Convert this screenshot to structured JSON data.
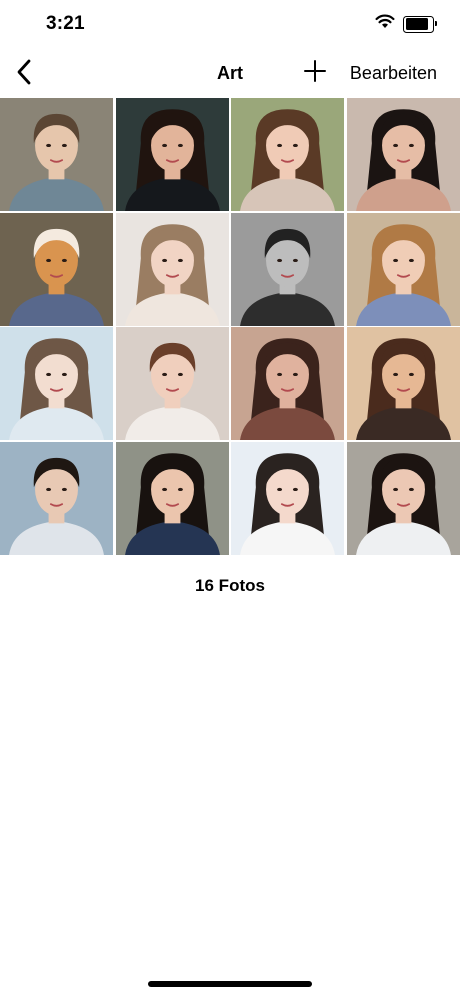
{
  "status_bar": {
    "time": "3:21",
    "battery_level": 0.85
  },
  "nav": {
    "title": "Art",
    "edit_label": "Bearbeiten"
  },
  "photos": [
    {
      "name": "photo-young-man-long-hair",
      "bg": "#8a8476",
      "skin": "#e6c6ac",
      "hair": "#5b4634",
      "shirt": "#6f8796",
      "long": false
    },
    {
      "name": "photo-woman-dark-hair-smiling",
      "bg": "#2e3b3a",
      "skin": "#e2b49a",
      "hair": "#20140f",
      "shirt": "#15181c",
      "long": true
    },
    {
      "name": "photo-woman-outdoor-brown-hair",
      "bg": "#9aa77a",
      "skin": "#f0cbb6",
      "hair": "#5a3a26",
      "shirt": "#d7c5b8",
      "long": true
    },
    {
      "name": "photo-woman-red-lips-closeup",
      "bg": "#c9b9ae",
      "skin": "#e6bda6",
      "hair": "#1b1412",
      "shirt": "#cfa08c",
      "long": true
    },
    {
      "name": "photo-shiba-dog-costume",
      "bg": "#6e6350",
      "skin": "#d9944f",
      "hair": "#f4eadf",
      "shirt": "#58688c",
      "long": false
    },
    {
      "name": "photo-woman-blonde-hand-face",
      "bg": "#e9e4e0",
      "skin": "#f1d4c4",
      "hair": "#9a7d62",
      "shirt": "#efe6de",
      "long": true
    },
    {
      "name": "photo-man-black-white",
      "bg": "#9b9b9b",
      "skin": "#bdbdbd",
      "hair": "#222222",
      "shirt": "#2d2d2d",
      "long": false
    },
    {
      "name": "photo-woman-curly-blonde",
      "bg": "#c9b59a",
      "skin": "#f0cdb6",
      "hair": "#b07a45",
      "shirt": "#7d8fba",
      "long": true
    },
    {
      "name": "photo-woman-white-lace",
      "bg": "#cfe0ea",
      "skin": "#f2ddd0",
      "hair": "#6e5746",
      "shirt": "#dfe9f0",
      "long": true
    },
    {
      "name": "photo-woman-glasses-bob",
      "bg": "#d9cfc8",
      "skin": "#f0cfbd",
      "hair": "#6a3f2a",
      "shirt": "#f1ece8",
      "long": false
    },
    {
      "name": "photo-woman-sunglasses-red",
      "bg": "#c7a491",
      "skin": "#e0b29e",
      "hair": "#3b231c",
      "shirt": "#7b4a3e",
      "long": true
    },
    {
      "name": "photo-woman-wavy-brown",
      "bg": "#e0c2a2",
      "skin": "#e6b894",
      "hair": "#4a2b1d",
      "shirt": "#3a2a24",
      "long": true
    },
    {
      "name": "photo-young-man-dark-hair",
      "bg": "#9db3c4",
      "skin": "#e8c9b4",
      "hair": "#1f1712",
      "shirt": "#dfe4ea",
      "long": false
    },
    {
      "name": "photo-woman-street-navy-top",
      "bg": "#8f9287",
      "skin": "#ebc5ad",
      "hair": "#18120f",
      "shirt": "#253553",
      "long": true
    },
    {
      "name": "photo-woman-lace-blindfold",
      "bg": "#e8eef4",
      "skin": "#f4d9cc",
      "hair": "#2a2320",
      "shirt": "#f6f6f6",
      "long": true
    },
    {
      "name": "photo-woman-city-street",
      "bg": "#a8a49c",
      "skin": "#ecc8b4",
      "hair": "#1c1411",
      "shirt": "#eef0f2",
      "long": true
    }
  ],
  "photo_count_label": "16 Fotos",
  "icons": {
    "back": "chevron-left-icon",
    "add": "plus-icon",
    "wifi": "wifi-icon",
    "battery": "battery-icon"
  }
}
